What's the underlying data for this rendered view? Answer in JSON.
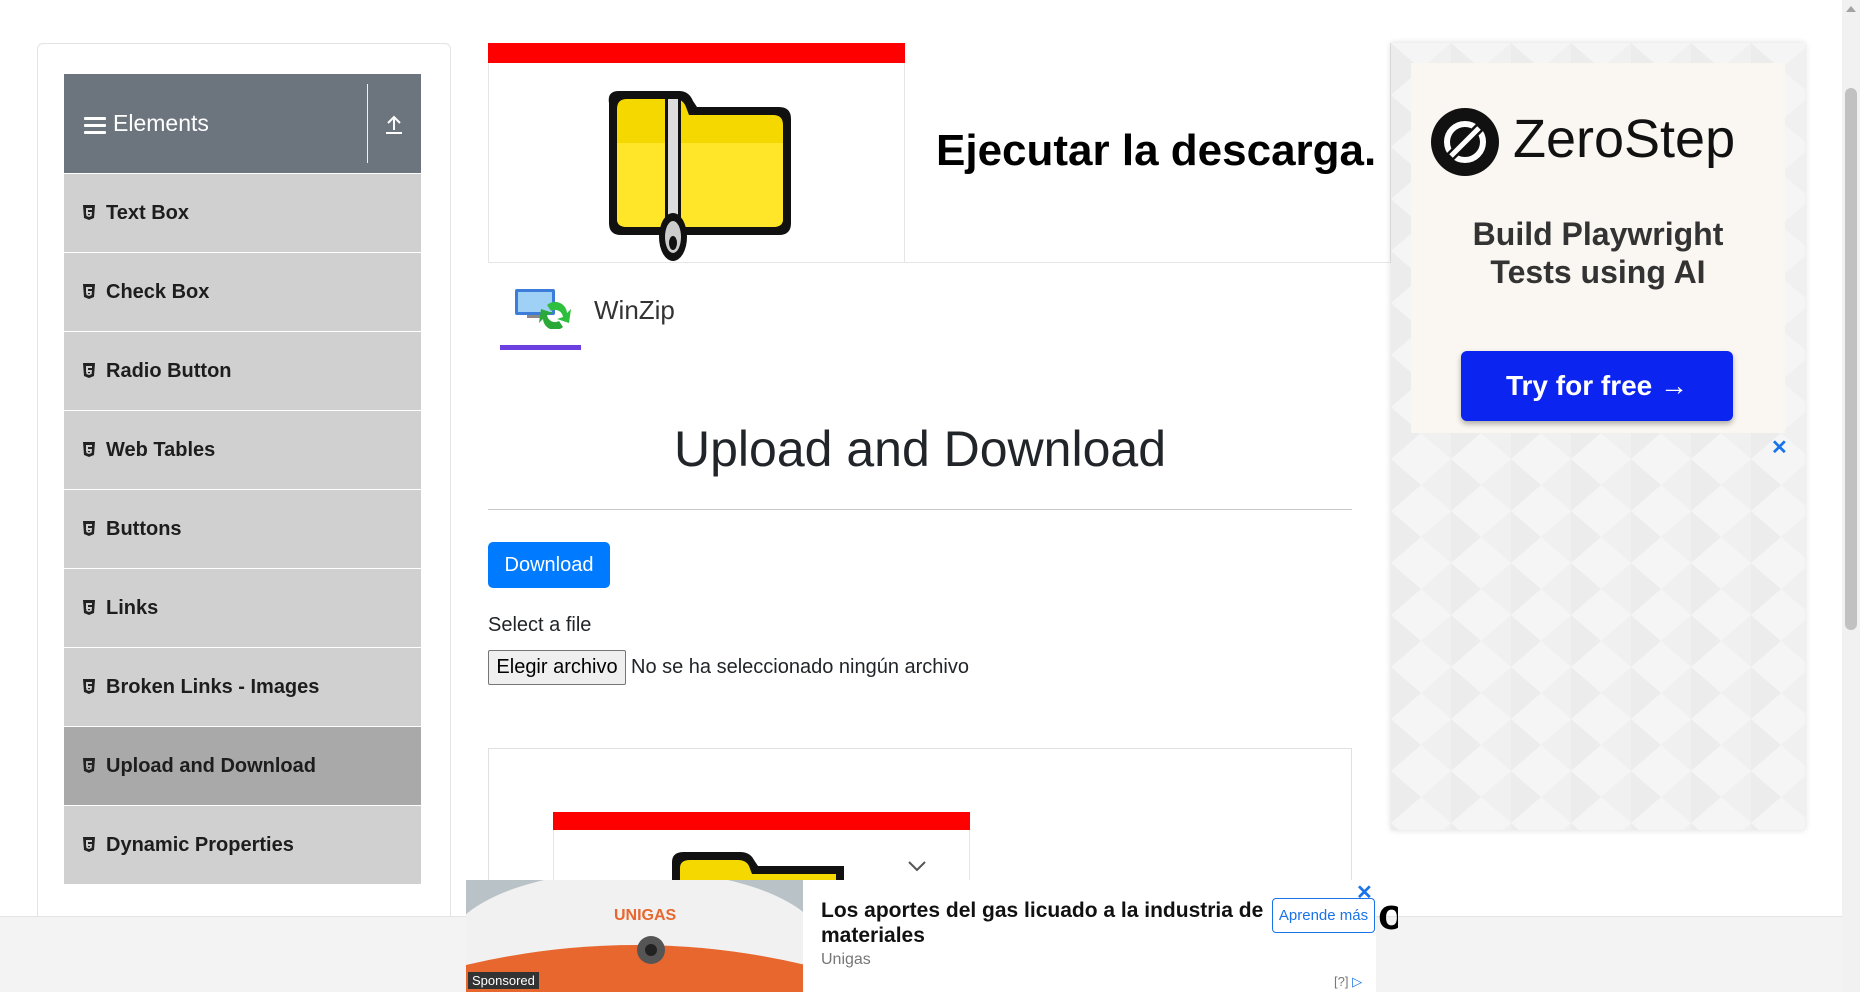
{
  "sidebar": {
    "group_title": "Elements",
    "items": [
      {
        "label": "Text Box"
      },
      {
        "label": "Check Box"
      },
      {
        "label": "Radio Button"
      },
      {
        "label": "Web Tables"
      },
      {
        "label": "Buttons"
      },
      {
        "label": "Links"
      },
      {
        "label": "Broken Links - Images"
      },
      {
        "label": "Upload and Download",
        "active": true
      },
      {
        "label": "Dynamic Properties"
      }
    ]
  },
  "top_banner": {
    "headline": "Ejecutar la descarga.",
    "tab_label": "WinZip",
    "icon": "zip-folder-icon"
  },
  "main": {
    "title": "Upload and Download",
    "download_label": "Download",
    "select_label": "Select a file",
    "file_button_label": "Elegir archivo",
    "file_status": "No se ha seleccionado ningún archivo"
  },
  "right_ad": {
    "brand": "ZeroStep",
    "tagline_line1": "Build Playwright",
    "tagline_line2": "Tests using AI",
    "cta": "Try for free →",
    "close": "✕",
    "colors": {
      "cta": "#0b24f0",
      "card": "#faf6f1"
    }
  },
  "bottom_ad": {
    "title": "Los aportes del gas licuado a la industria de materiales",
    "advertiser": "Unigas",
    "cta": "Aprende más",
    "sponsored": "Sponsored",
    "photo_logo": "UNIGAS",
    "close": "✕",
    "adchoices": "[?]"
  },
  "colors": {
    "sidebar_header": "#6c757d",
    "menu_item": "#d0d0d0",
    "menu_item_active": "#a9a9a9",
    "primary_button": "#007bff",
    "banner_red": "#ff0000",
    "tab_underline": "#6b3fe0"
  }
}
